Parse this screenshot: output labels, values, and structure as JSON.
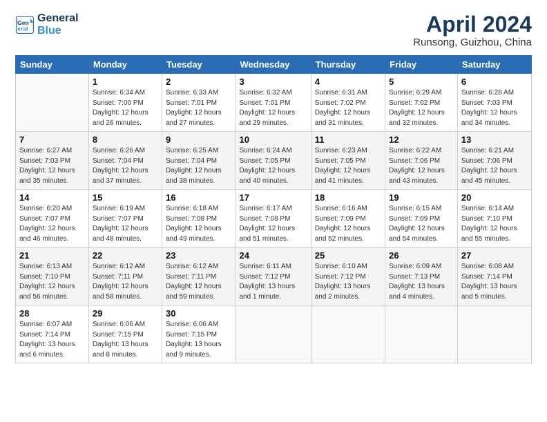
{
  "header": {
    "logo_line1": "General",
    "logo_line2": "Blue",
    "title": "April 2024",
    "subtitle": "Runsong, Guizhou, China"
  },
  "weekdays": [
    "Sunday",
    "Monday",
    "Tuesday",
    "Wednesday",
    "Thursday",
    "Friday",
    "Saturday"
  ],
  "weeks": [
    [
      {
        "day": "",
        "info": ""
      },
      {
        "day": "1",
        "info": "Sunrise: 6:34 AM\nSunset: 7:00 PM\nDaylight: 12 hours\nand 26 minutes."
      },
      {
        "day": "2",
        "info": "Sunrise: 6:33 AM\nSunset: 7:01 PM\nDaylight: 12 hours\nand 27 minutes."
      },
      {
        "day": "3",
        "info": "Sunrise: 6:32 AM\nSunset: 7:01 PM\nDaylight: 12 hours\nand 29 minutes."
      },
      {
        "day": "4",
        "info": "Sunrise: 6:31 AM\nSunset: 7:02 PM\nDaylight: 12 hours\nand 31 minutes."
      },
      {
        "day": "5",
        "info": "Sunrise: 6:29 AM\nSunset: 7:02 PM\nDaylight: 12 hours\nand 32 minutes."
      },
      {
        "day": "6",
        "info": "Sunrise: 6:28 AM\nSunset: 7:03 PM\nDaylight: 12 hours\nand 34 minutes."
      }
    ],
    [
      {
        "day": "7",
        "info": "Sunrise: 6:27 AM\nSunset: 7:03 PM\nDaylight: 12 hours\nand 35 minutes."
      },
      {
        "day": "8",
        "info": "Sunrise: 6:26 AM\nSunset: 7:04 PM\nDaylight: 12 hours\nand 37 minutes."
      },
      {
        "day": "9",
        "info": "Sunrise: 6:25 AM\nSunset: 7:04 PM\nDaylight: 12 hours\nand 38 minutes."
      },
      {
        "day": "10",
        "info": "Sunrise: 6:24 AM\nSunset: 7:05 PM\nDaylight: 12 hours\nand 40 minutes."
      },
      {
        "day": "11",
        "info": "Sunrise: 6:23 AM\nSunset: 7:05 PM\nDaylight: 12 hours\nand 41 minutes."
      },
      {
        "day": "12",
        "info": "Sunrise: 6:22 AM\nSunset: 7:06 PM\nDaylight: 12 hours\nand 43 minutes."
      },
      {
        "day": "13",
        "info": "Sunrise: 6:21 AM\nSunset: 7:06 PM\nDaylight: 12 hours\nand 45 minutes."
      }
    ],
    [
      {
        "day": "14",
        "info": "Sunrise: 6:20 AM\nSunset: 7:07 PM\nDaylight: 12 hours\nand 46 minutes."
      },
      {
        "day": "15",
        "info": "Sunrise: 6:19 AM\nSunset: 7:07 PM\nDaylight: 12 hours\nand 48 minutes."
      },
      {
        "day": "16",
        "info": "Sunrise: 6:18 AM\nSunset: 7:08 PM\nDaylight: 12 hours\nand 49 minutes."
      },
      {
        "day": "17",
        "info": "Sunrise: 6:17 AM\nSunset: 7:08 PM\nDaylight: 12 hours\nand 51 minutes."
      },
      {
        "day": "18",
        "info": "Sunrise: 6:16 AM\nSunset: 7:09 PM\nDaylight: 12 hours\nand 52 minutes."
      },
      {
        "day": "19",
        "info": "Sunrise: 6:15 AM\nSunset: 7:09 PM\nDaylight: 12 hours\nand 54 minutes."
      },
      {
        "day": "20",
        "info": "Sunrise: 6:14 AM\nSunset: 7:10 PM\nDaylight: 12 hours\nand 55 minutes."
      }
    ],
    [
      {
        "day": "21",
        "info": "Sunrise: 6:13 AM\nSunset: 7:10 PM\nDaylight: 12 hours\nand 56 minutes."
      },
      {
        "day": "22",
        "info": "Sunrise: 6:12 AM\nSunset: 7:11 PM\nDaylight: 12 hours\nand 58 minutes."
      },
      {
        "day": "23",
        "info": "Sunrise: 6:12 AM\nSunset: 7:11 PM\nDaylight: 12 hours\nand 59 minutes."
      },
      {
        "day": "24",
        "info": "Sunrise: 6:11 AM\nSunset: 7:12 PM\nDaylight: 13 hours\nand 1 minute."
      },
      {
        "day": "25",
        "info": "Sunrise: 6:10 AM\nSunset: 7:12 PM\nDaylight: 13 hours\nand 2 minutes."
      },
      {
        "day": "26",
        "info": "Sunrise: 6:09 AM\nSunset: 7:13 PM\nDaylight: 13 hours\nand 4 minutes."
      },
      {
        "day": "27",
        "info": "Sunrise: 6:08 AM\nSunset: 7:14 PM\nDaylight: 13 hours\nand 5 minutes."
      }
    ],
    [
      {
        "day": "28",
        "info": "Sunrise: 6:07 AM\nSunset: 7:14 PM\nDaylight: 13 hours\nand 6 minutes."
      },
      {
        "day": "29",
        "info": "Sunrise: 6:06 AM\nSunset: 7:15 PM\nDaylight: 13 hours\nand 8 minutes."
      },
      {
        "day": "30",
        "info": "Sunrise: 6:06 AM\nSunset: 7:15 PM\nDaylight: 13 hours\nand 9 minutes."
      },
      {
        "day": "",
        "info": ""
      },
      {
        "day": "",
        "info": ""
      },
      {
        "day": "",
        "info": ""
      },
      {
        "day": "",
        "info": ""
      }
    ]
  ]
}
